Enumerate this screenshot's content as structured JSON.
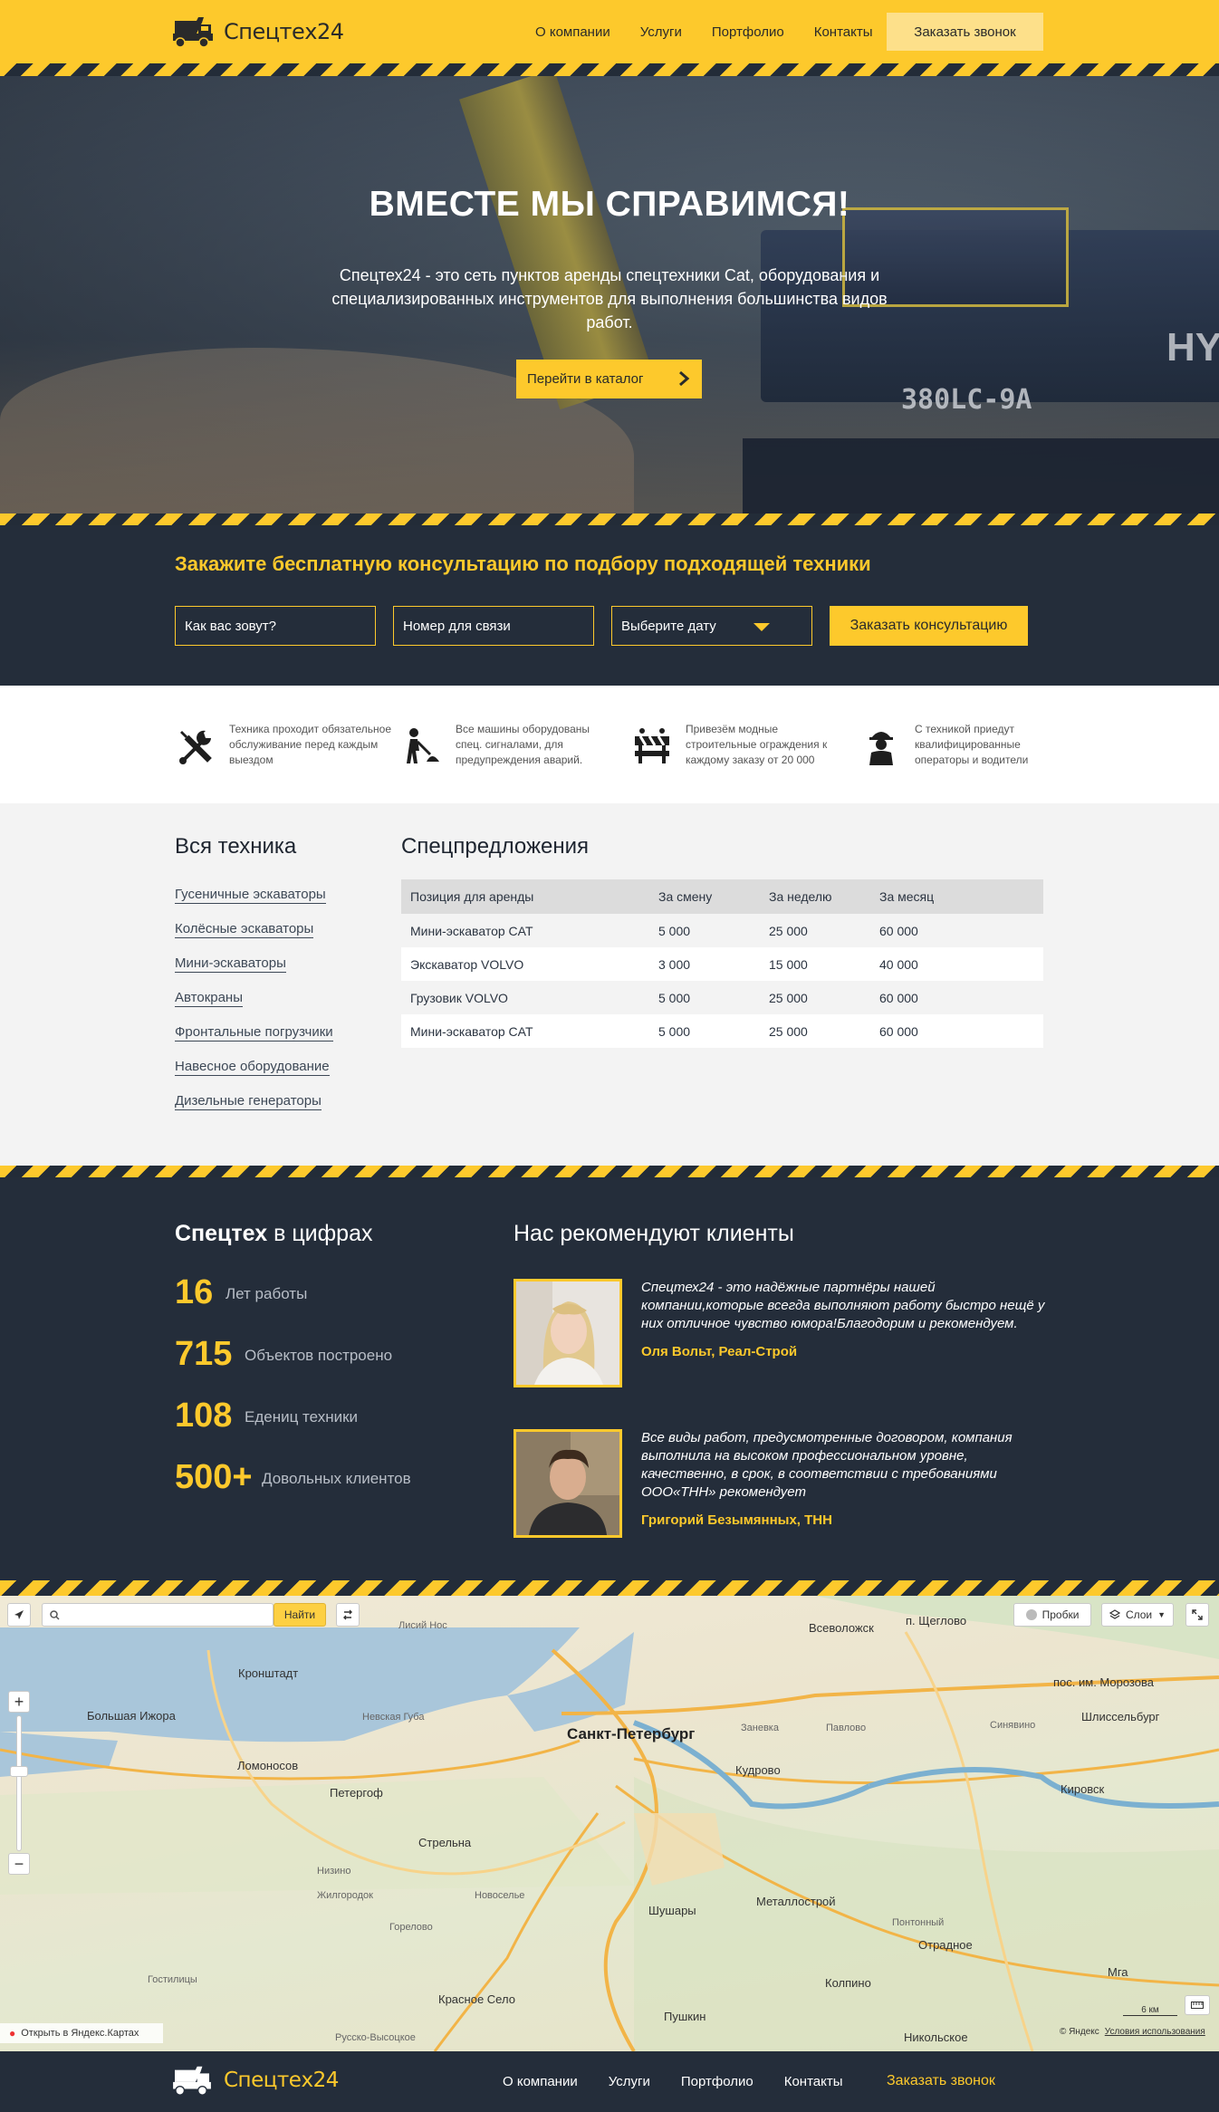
{
  "header": {
    "brand": "Спецтех24",
    "nav": [
      "О компании",
      "Услуги",
      "Портфолио",
      "Контакты"
    ],
    "call_button": "Заказать звонок"
  },
  "hero": {
    "title": "ВМЕСТЕ МЫ СПРАВИМСЯ!",
    "text": "Спецтех24 - это сеть пунктов аренды спецтехники Cat, оборудования и специализированных инструментов для выполнения большинства видов работ.",
    "button": "Перейти в каталог",
    "machine_model": "380LC-9A",
    "machine_brand": "HYU"
  },
  "consult": {
    "title": "Закажите бесплатную консультацию по подбору подходящей техники",
    "name_placeholder": "Как вас зовут?",
    "phone_placeholder": "Номер для связи",
    "date_placeholder": "Выберите дату",
    "button": "Заказать консультацию"
  },
  "features": [
    {
      "icon": "tools-icon",
      "text": "Техника проходит обязательное обслуживание перед каждым выездом"
    },
    {
      "icon": "worker-icon",
      "text": "Все машины оборудованы спец. сигналами, для предупреждения аварий."
    },
    {
      "icon": "barrier-icon",
      "text": "Привезём модные строительные ограждения к каждому заказу от 20 000"
    },
    {
      "icon": "operator-icon",
      "text": "С техникой приедут квалифицированные операторы и водители"
    }
  ],
  "catalog": {
    "title": "Вся техника",
    "links": [
      "Гусеничные эскаваторы",
      "Колёсные эскаваторы",
      "Мини-эскаваторы",
      "Автокраны",
      "Фронтальные погрузчики",
      "Навесное оборудование",
      "Дизельные генераторы"
    ]
  },
  "offers": {
    "title": "Спецпредложения",
    "headers": [
      "Позиция для аренды",
      "За смену",
      "За неделю",
      "За месяц"
    ],
    "rows": [
      [
        "Мини-эскаватор CAT",
        "5 000",
        "25 000",
        "60 000"
      ],
      [
        "Экскаватор VOLVO",
        "3 000",
        "15 000",
        "40 000"
      ],
      [
        "Грузовик VOLVO",
        "5 000",
        "25 000",
        "60 000"
      ],
      [
        "Мини-эскаватор CAT",
        "5 000",
        "25 000",
        "60 000"
      ]
    ]
  },
  "stats": {
    "title_bold": "Спецтех",
    "title_rest": " в цифрах",
    "items": [
      {
        "value": "16",
        "label": "Лет работы"
      },
      {
        "value": "715",
        "label": "Объектов построено"
      },
      {
        "value": "108",
        "label": "Едениц техники"
      },
      {
        "value": "500+",
        "label": "Довольных клиентов"
      }
    ]
  },
  "reviews": {
    "title": "Нас рекомендуют клиенты",
    "items": [
      {
        "text": "Спецтех24 - это надёжные партнёры нашей компании,которые всегда выполняют работу быстро нещё у них отличное чувство юмора!Благодорим и рекомендуем.",
        "author": "Оля Вольт, Реал-Строй"
      },
      {
        "text": "Все виды работ, предусмотренные договором, компания выполнила на высоком профессиональном уровне, качественно, в срок, в соответствии с требованиями ООО«ТНН» рекомендует",
        "author": "Григорий Безымянных, ТНН"
      }
    ]
  },
  "map": {
    "search_button": "Найти",
    "traffic": "Пробки",
    "layers": "Слои",
    "open_link": "Открыть в Яндекс.Картах",
    "copyright": "© Яндекс",
    "terms": "Условия использования",
    "scale": "6 км",
    "labels": [
      {
        "text": "Санкт-Петербург",
        "cls": "big"
      },
      {
        "text": "Кронштадт",
        "cls": ""
      },
      {
        "text": "Большая Ижора",
        "cls": ""
      },
      {
        "text": "Ломоносов",
        "cls": ""
      },
      {
        "text": "Петергоф",
        "cls": ""
      },
      {
        "text": "Стрельна",
        "cls": ""
      },
      {
        "text": "Низино",
        "cls": "small"
      },
      {
        "text": "Жилгородок",
        "cls": "small"
      },
      {
        "text": "Новоселье",
        "cls": "small"
      },
      {
        "text": "Горелово",
        "cls": "small"
      },
      {
        "text": "Шушары",
        "cls": ""
      },
      {
        "text": "Металлострой",
        "cls": ""
      },
      {
        "text": "Кудрово",
        "cls": ""
      },
      {
        "text": "Заневка",
        "cls": "small"
      },
      {
        "text": "Павлово",
        "cls": "small"
      },
      {
        "text": "Отрадное",
        "cls": ""
      },
      {
        "text": "Колпино",
        "cls": ""
      },
      {
        "text": "Пушкин",
        "cls": ""
      },
      {
        "text": "Красное Село",
        "cls": ""
      },
      {
        "text": "Гостилицы",
        "cls": "small"
      },
      {
        "text": "Всеволожск",
        "cls": ""
      },
      {
        "text": "Кировск",
        "cls": ""
      },
      {
        "text": "Шлиссельбург",
        "cls": ""
      },
      {
        "text": "Мга",
        "cls": ""
      },
      {
        "text": "Никольское",
        "cls": ""
      },
      {
        "text": "Лисий Нос",
        "cls": "small"
      },
      {
        "text": "Невская Губа",
        "cls": "small"
      },
      {
        "text": "пос. им. Морозова",
        "cls": ""
      },
      {
        "text": "п. Щеглово",
        "cls": "small"
      },
      {
        "text": "Синявино",
        "cls": "small"
      },
      {
        "text": "Понтонный",
        "cls": "small"
      },
      {
        "text": "Русско-Высоцкое",
        "cls": "small"
      }
    ]
  },
  "footer": {
    "brand": "Спецтех24",
    "nav": [
      "О компании",
      "Услуги",
      "Портфолио",
      "Контакты"
    ],
    "call": "Заказать звонок"
  },
  "colors": {
    "accent": "#fdc92c",
    "dark": "#242d3a",
    "light": "#f3f3f3"
  }
}
